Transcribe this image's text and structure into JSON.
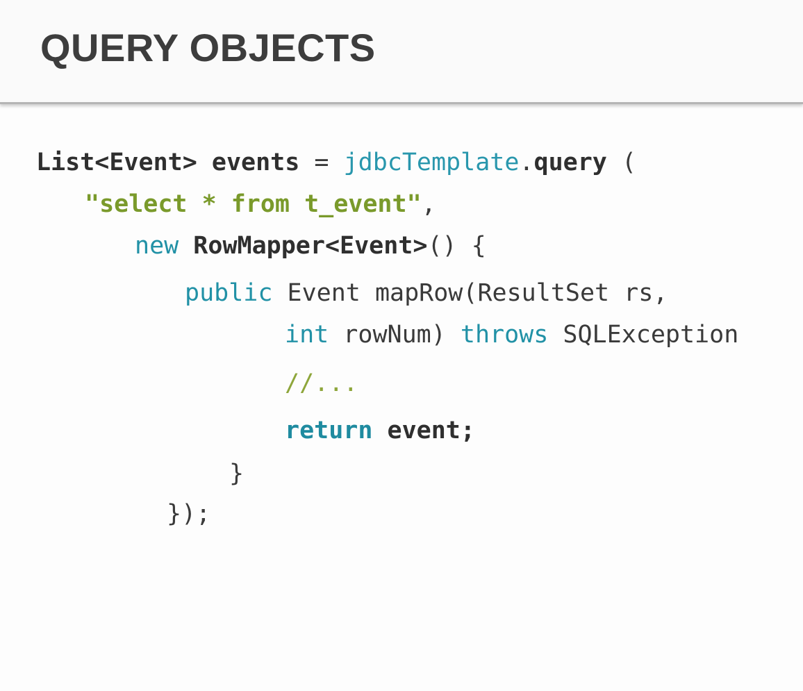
{
  "slide": {
    "title": "QUERY OBJECTS"
  },
  "code": {
    "line1": {
      "type_name": "List<Event>",
      "var_name": "events",
      "equals": "=",
      "receiver": "jdbcTemplate",
      "dot": ".",
      "method": "query",
      "open_paren": "("
    },
    "line2": {
      "sql": "\"select * from t_event\"",
      "comma": ","
    },
    "line3": {
      "new_kw": "new",
      "class_name": "RowMapper<Event>",
      "rest": "() {"
    },
    "line4": {
      "public_kw": "public",
      "signature": "Event mapRow(ResultSet rs,"
    },
    "line5": {
      "int_kw": "int",
      "param": "rowNum)",
      "throws_kw": "throws",
      "exception": "SQLException"
    },
    "line6": {
      "comment": "//..."
    },
    "line7": {
      "return_kw": "return",
      "value": "event;"
    },
    "line8": {
      "brace": "}"
    },
    "line9": {
      "closing": "});"
    }
  }
}
